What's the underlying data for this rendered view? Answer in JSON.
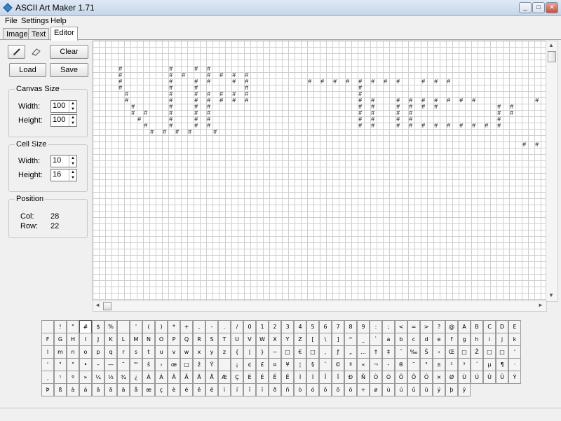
{
  "window": {
    "title": "ASCII Art Maker 1.71",
    "minimize": "_",
    "maximize": "□",
    "close": "✕"
  },
  "menu": [
    "File",
    "Settings",
    "Help"
  ],
  "tabs": [
    "Image",
    "Text",
    "Editor"
  ],
  "toolbar": {
    "pencil_icon": "pencil-icon",
    "eraser_icon": "eraser-icon",
    "clear_label": "Clear",
    "load_label": "Load",
    "save_label": "Save"
  },
  "canvas_size": {
    "label": "Canvas Size",
    "width_label": "Width:",
    "width_value": "100",
    "height_label": "Height:",
    "height_value": "100"
  },
  "cell_size": {
    "label": "Cell Size",
    "width_label": "Width:",
    "width_value": "10",
    "height_label": "Height:",
    "height_value": "16"
  },
  "position": {
    "label": "Position",
    "col_label": "Col:",
    "col_value": "28",
    "row_label": "Row:",
    "row_value": "22"
  },
  "art_rows": [
    "",
    "",
    "",
    "",
    "    #       #   # #",
    "    #       # #   # # # #",
    "    #       #   # #   # #         # # # # # # # #   # # #",
    "    #       #   #       #                 #",
    "     #      #   # # # # #                 #",
    "     #      #   # # # # #                 # #   # # # # # # #         # # # # # #",
    "      #     #   # #                       # #   # # # #         # #           # # # #",
    "      # #   #   # #                       # #   # #             # #           #       # #",
    "       #    #   # #                       # #   # #             #             # #       #",
    "        #   #   # #                       # #   # # # # # # # # #             #           #",
    "         # # # #   #                                                           #           #",
    "                                                                               #   # # #       #",
    "                                                                    # # # # # # #       # # # # # # # # #     # # # # #",
    "                                                                               # #           # # # # # # # # # #   # #",
    "                                                                               # # # # # # # #           # #     # #"
  ],
  "charmap_rows": [
    [
      "",
      "!",
      "\"",
      "#",
      "$",
      "%",
      "",
      "'",
      "(",
      ")",
      "*",
      "+",
      ",",
      "-",
      ".",
      "/",
      "0",
      "1",
      "2",
      "3",
      "4",
      "5",
      "6",
      "7",
      "8",
      "9",
      ":",
      ";",
      "<",
      "=",
      ">",
      "?",
      "@",
      "A",
      "B",
      "C",
      "D",
      "E"
    ],
    [
      "F",
      "G",
      "H",
      "I",
      "J",
      "K",
      "L",
      "M",
      "N",
      "O",
      "P",
      "Q",
      "R",
      "S",
      "T",
      "U",
      "V",
      "W",
      "X",
      "Y",
      "Z",
      "[",
      "\\",
      "]",
      "^",
      "_",
      "`",
      "a",
      "b",
      "c",
      "d",
      "e",
      "f",
      "g",
      "h",
      "i",
      "j",
      "k"
    ],
    [
      "l",
      "m",
      "n",
      "o",
      "p",
      "q",
      "r",
      "s",
      "t",
      "u",
      "v",
      "w",
      "x",
      "y",
      "z",
      "{",
      "|",
      "}",
      "~",
      "□",
      "€",
      "□",
      ",",
      "ƒ",
      "„",
      "…",
      "†",
      "‡",
      "ˆ",
      "‰",
      "Š",
      "‹",
      "Œ",
      "□",
      "Ž",
      "□",
      "□",
      "'"
    ],
    [
      "'",
      "\"",
      "\"",
      "•",
      "–",
      "—",
      "˜",
      "™",
      "š",
      "›",
      "œ",
      "□",
      "ž",
      "Ÿ",
      "",
      "¡",
      "¢",
      "£",
      "¤",
      "¥",
      "¦",
      "§",
      "¨",
      "©",
      "ª",
      "«",
      "¬",
      "-",
      "®",
      "¯",
      "°",
      "±",
      "²",
      "³",
      "´",
      "µ",
      "¶",
      "·"
    ],
    [
      "¸",
      "¹",
      "º",
      "»",
      "¼",
      "½",
      "¾",
      "¿",
      "À",
      "Á",
      "Â",
      "Ã",
      "Ä",
      "Å",
      "Æ",
      "Ç",
      "È",
      "É",
      "Ê",
      "Ë",
      "Ì",
      "Í",
      "Î",
      "Ï",
      "Ð",
      "Ñ",
      "Ò",
      "Ó",
      "Ô",
      "Õ",
      "Ö",
      "×",
      "Ø",
      "Ù",
      "Ú",
      "Û",
      "Ü",
      "Ý"
    ],
    [
      "Þ",
      "ß",
      "à",
      "á",
      "â",
      "ã",
      "ä",
      "å",
      "æ",
      "ç",
      "è",
      "é",
      "ê",
      "ë",
      "ì",
      "í",
      "î",
      "ï",
      "ð",
      "ñ",
      "ò",
      "ó",
      "ô",
      "õ",
      "ö",
      "÷",
      "ø",
      "ù",
      "ú",
      "û",
      "ü",
      "ý",
      "þ",
      "ÿ"
    ]
  ],
  "selected_char": "#"
}
